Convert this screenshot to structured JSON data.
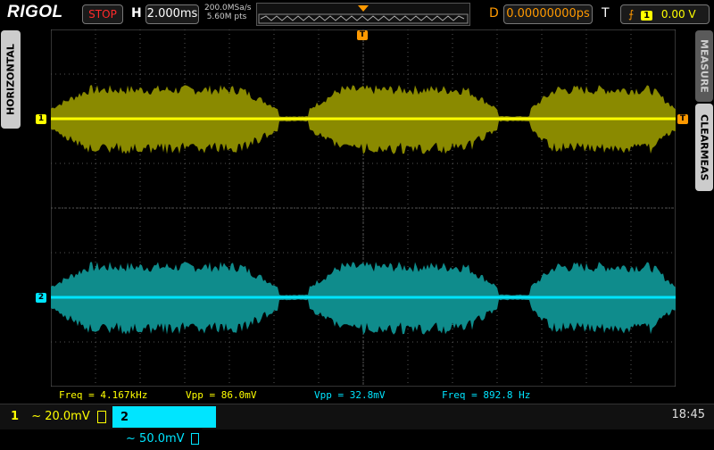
{
  "app": {
    "brand": "RIGOL"
  },
  "top": {
    "run_state": "STOP",
    "horizontal_label": "H",
    "timebase": "2.000ms",
    "sample_rate": "200.0MSa/s",
    "memory_depth": "5.60M pts",
    "delay_label": "D",
    "delay": "0.00000000ps",
    "trigger_label": "T",
    "trigger_source": "1",
    "trigger_level": "0.00 V"
  },
  "side": {
    "horizontal_tab": "HORIZONTAL",
    "measure_tab": "MEASURE",
    "clear_tab": "CLEARMEAS"
  },
  "markers": {
    "ch1": "1",
    "ch2": "2",
    "trigger_position": "T",
    "trigger_level_marker": "T"
  },
  "measurements": [
    {
      "text": "Freq = 4.167kHz",
      "color": "#ffff00"
    },
    {
      "text": "Vpp = 86.0mV",
      "color": "#ffff00"
    },
    {
      "text": "Vpp = 32.8mV",
      "color": "#00e5ff"
    },
    {
      "text": "Freq = 892.8 Hz",
      "color": "#00e5ff"
    }
  ],
  "channels": [
    {
      "number": "1",
      "coupling": "~",
      "scale": "20.0mV",
      "color": "#ffff00"
    },
    {
      "number": "2",
      "coupling": "~",
      "scale": "50.0mV",
      "color": "#00e5ff"
    }
  ],
  "clock": "18:45",
  "colors": {
    "ch1": "#ffff00",
    "ch1_envelope": "#8a8a00",
    "ch2": "#00e5ff",
    "ch2_envelope": "#0f8c8c",
    "trigger": "#ff9900"
  }
}
